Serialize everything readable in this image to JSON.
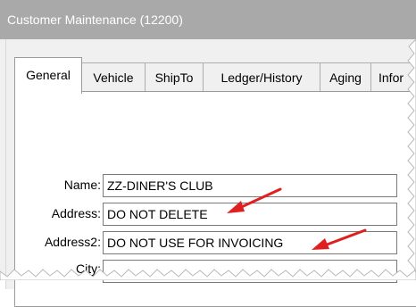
{
  "window": {
    "title": "Customer Maintenance (12200)"
  },
  "tabs": [
    {
      "label": "General",
      "active": true
    },
    {
      "label": "Vehicle",
      "active": false
    },
    {
      "label": "ShipTo",
      "active": false
    },
    {
      "label": "Ledger/History",
      "active": false
    },
    {
      "label": "Aging",
      "active": false
    },
    {
      "label": "Infor",
      "active": false
    }
  ],
  "form": {
    "name_label": "Name:",
    "name_value": "ZZ-DINER'S CLUB",
    "address_label": "Address:",
    "address_value": "DO NOT DELETE",
    "address2_label": "Address2:",
    "address2_value": "DO NOT USE FOR INVOICING",
    "city_label": "City:",
    "city_value": ""
  },
  "colors": {
    "titlebar": "#a9a9a9",
    "annotation_arrow": "#e02020"
  },
  "annotations": [
    "arrow-pointing-to-address",
    "arrow-pointing-to-address2"
  ]
}
